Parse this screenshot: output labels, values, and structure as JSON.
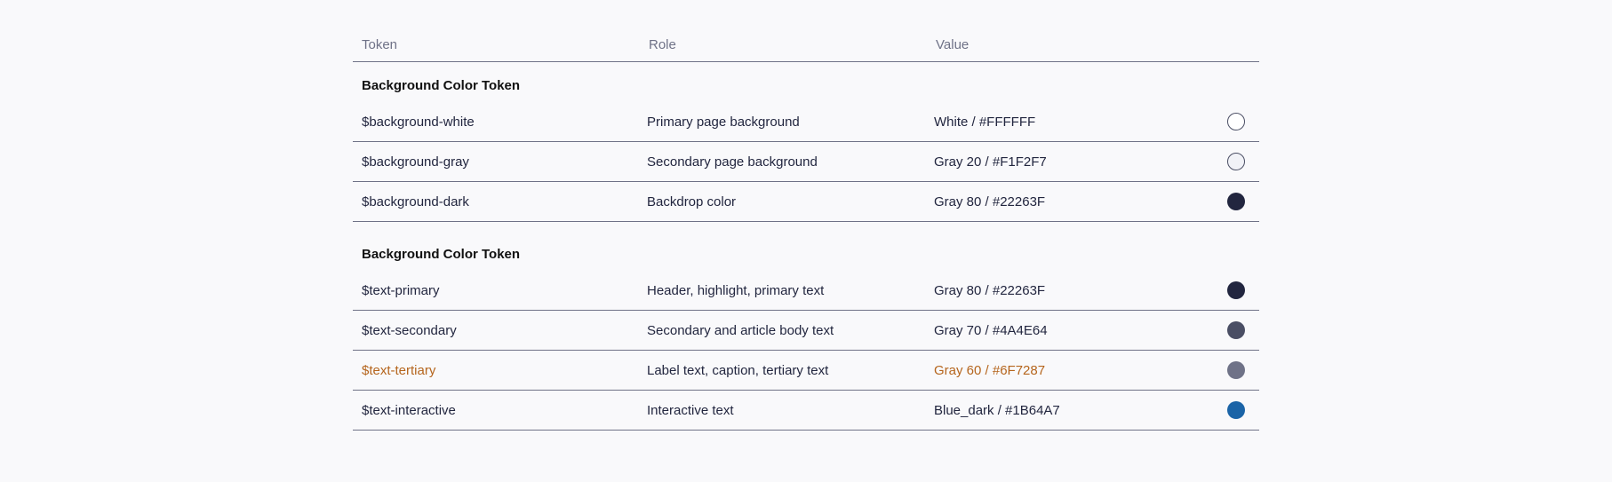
{
  "header": {
    "token": "Token",
    "role": "Role",
    "value": "Value"
  },
  "sections": [
    {
      "title": "Background Color Token",
      "rows": [
        {
          "token": "$background-white",
          "role": "Primary page background",
          "value": "White / #FFFFFF",
          "swatch": "#FFFFFF",
          "outline": true,
          "highlight": false
        },
        {
          "token": "$background-gray",
          "role": "Secondary page background",
          "value": "Gray 20 / #F1F2F7",
          "swatch": "#F1F2F7",
          "outline": true,
          "highlight": false
        },
        {
          "token": "$background-dark",
          "role": "Backdrop color",
          "value": "Gray 80 / #22263F",
          "swatch": "#22263F",
          "outline": false,
          "highlight": false
        }
      ]
    },
    {
      "title": "Background Color Token",
      "rows": [
        {
          "token": "$text-primary",
          "role": "Header, highlight, primary text",
          "value": "Gray 80 / #22263F",
          "swatch": "#22263F",
          "outline": false,
          "highlight": false
        },
        {
          "token": "$text-secondary",
          "role": "Secondary and article body text",
          "value": "Gray 70 / #4A4E64",
          "swatch": "#4A4E64",
          "outline": false,
          "highlight": false
        },
        {
          "token": "$text-tertiary",
          "role": "Label text, caption, tertiary text",
          "value": "Gray 60 / #6F7287",
          "swatch": "#6F7287",
          "outline": false,
          "highlight": true
        },
        {
          "token": "$text-interactive",
          "role": "Interactive text",
          "value": "Blue_dark / #1B64A7",
          "swatch": "#1B64A7",
          "outline": false,
          "highlight": false
        }
      ]
    }
  ],
  "colors": {
    "highlight_text": "#B5651D",
    "divider": "#6F7287",
    "page_background": "#F9F9FB"
  }
}
